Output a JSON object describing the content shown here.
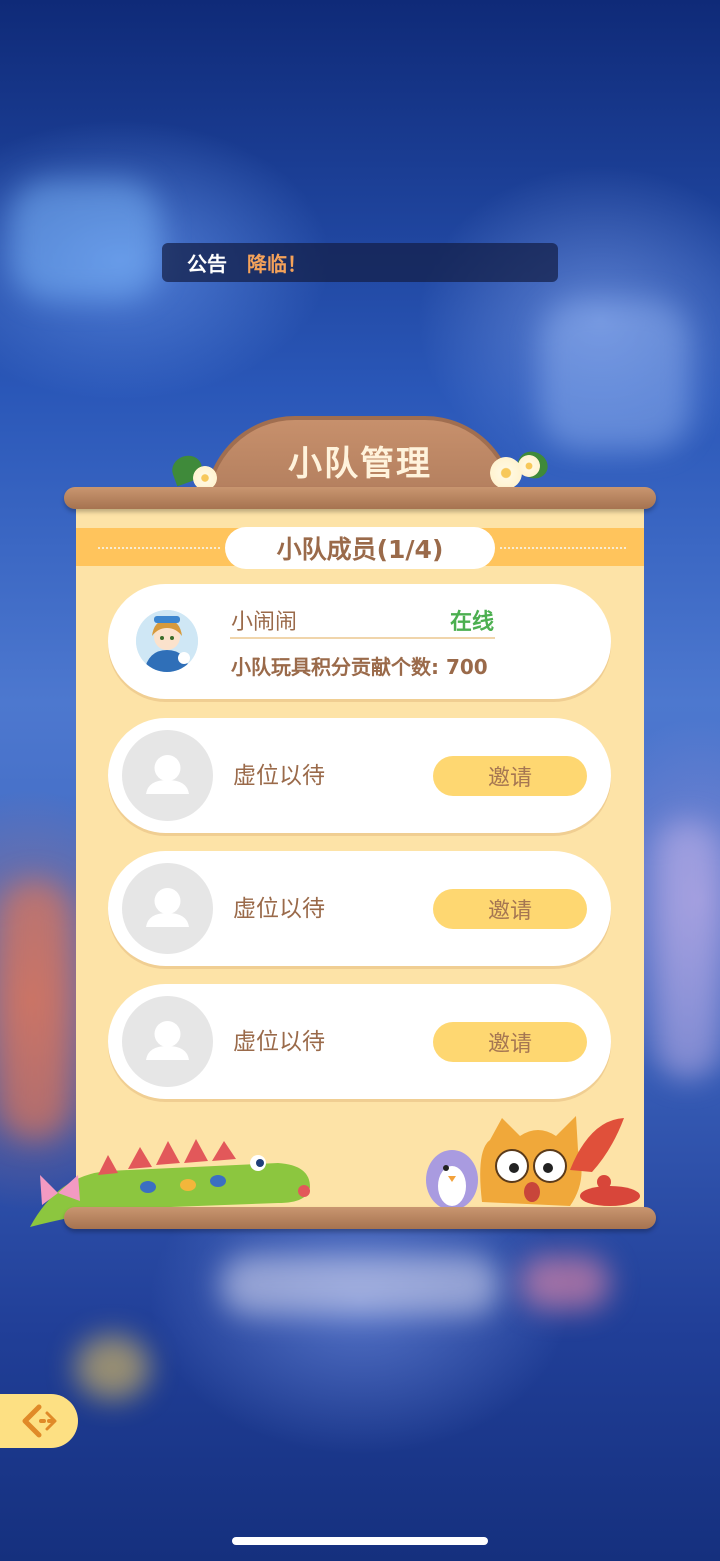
{
  "announcement": {
    "label": "公告",
    "text": "降临！"
  },
  "panel": {
    "title": "小队管理",
    "subtitle": "小队成员(1/4)"
  },
  "members": [
    {
      "name": "小闹闹",
      "status": "在线",
      "contribution": "小队玩具积分贡献个数: 700"
    }
  ],
  "empty_slots": [
    {
      "text": "虚位以待",
      "button": "邀请"
    },
    {
      "text": "虚位以待",
      "button": "邀请"
    },
    {
      "text": "虚位以待",
      "button": "邀请"
    }
  ],
  "colors": {
    "panel_bg": "#fde3a7",
    "accent_band": "#ffc45c",
    "invite_button": "#fed771",
    "online_status": "#4caf50",
    "text_brown": "#9a6a4a"
  },
  "icons": {
    "back": "back-arrow-icon",
    "empty_avatar": "person-placeholder-icon"
  }
}
